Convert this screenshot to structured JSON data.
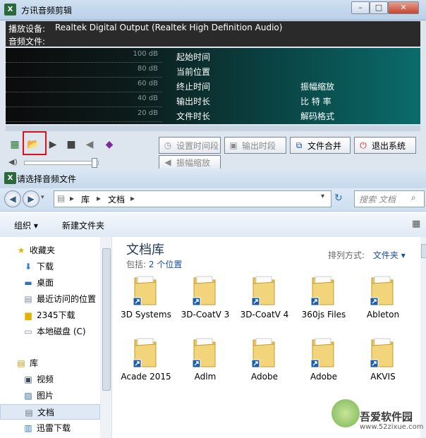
{
  "editor": {
    "title": "方讯音频剪辑",
    "device_label": "播放设备:",
    "device_value": "Realtek Digital Output (Realtek High Definition Audio)",
    "file_label": "音频文件:",
    "db_levels": [
      "100 dB",
      "80 dB",
      "60 dB",
      "40 dB",
      "20 dB"
    ],
    "info_col1": [
      "起始时间",
      "当前位置",
      "终止时间",
      "输出时长",
      "文件时长"
    ],
    "info_col2": [
      "振幅缩放",
      "比 特 率",
      "解码格式"
    ],
    "buttons": {
      "set_period": "设置时间段",
      "output_period": "输出时段",
      "merge": "文件合并",
      "exit": "退出系统",
      "amp_scale": "振幅缩放"
    },
    "icons": [
      "record-icon",
      "open-folder-icon",
      "play-icon",
      "stop-icon",
      "speaker-icon",
      "book-icon"
    ]
  },
  "dialog": {
    "title": "请选择音频文件",
    "address": {
      "root": "库",
      "folder": "文档"
    },
    "search_placeholder": "搜索 文档",
    "commands": {
      "organize": "组织 ▾",
      "new_folder": "新建文件夹"
    },
    "nav": {
      "favorites_header": "收藏夹",
      "favorites": [
        "下载",
        "桌面",
        "最近访问的位置",
        "2345下载",
        "本地磁盘 (C)"
      ],
      "libraries_header": "库",
      "libraries": [
        "视频",
        "图片",
        "文档",
        "迅雷下载"
      ],
      "selected": "文档"
    },
    "library": {
      "title": "文档库",
      "includes_label": "包括:",
      "includes_link": "2 个位置",
      "arrange_label": "排列方式:",
      "arrange_value": "文件夹 ▾"
    },
    "folders": [
      "3D Systems",
      "3D-CoatV 3",
      "3D-CoatV 4",
      "360js Files",
      "Ableton",
      "Acade 2015",
      "Adlm",
      "Adobe",
      "Adobe",
      "AKVIS"
    ]
  },
  "watermark": {
    "brand": "吾爱软件园",
    "url": "www.52zixue.com"
  },
  "colors": {
    "highlight": "#e0101a",
    "display_teal": "#0b6b6b",
    "title_bar": "#c7d9ec"
  }
}
